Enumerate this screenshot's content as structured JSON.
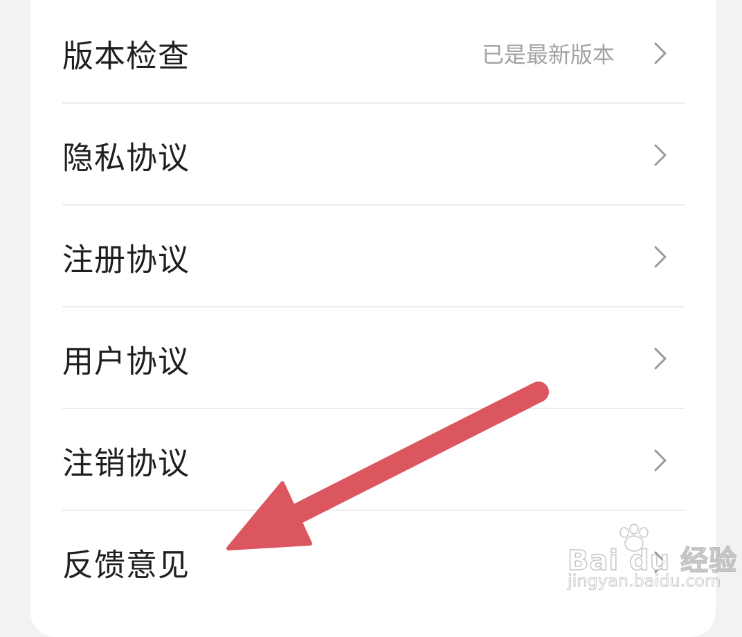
{
  "settings": {
    "items": [
      {
        "label": "版本检查",
        "value": "已是最新版本"
      },
      {
        "label": "隐私协议",
        "value": ""
      },
      {
        "label": "注册协议",
        "value": ""
      },
      {
        "label": "用户协议",
        "value": ""
      },
      {
        "label": "注销协议",
        "value": ""
      },
      {
        "label": "反馈意见",
        "value": ""
      }
    ]
  },
  "annotation": {
    "arrow_color": "#dc5660",
    "icon": "red-arrow-pointing-to-feedback"
  },
  "watermark": {
    "brand": "Bai du 经验",
    "url": "jingyan.baidu.com"
  },
  "colors": {
    "background": "#f2f2f2",
    "card": "#ffffff",
    "text": "#1f1f1f",
    "secondary_text": "#a3a3a3",
    "chevron": "#9a9a9a",
    "divider": "#ececec"
  }
}
